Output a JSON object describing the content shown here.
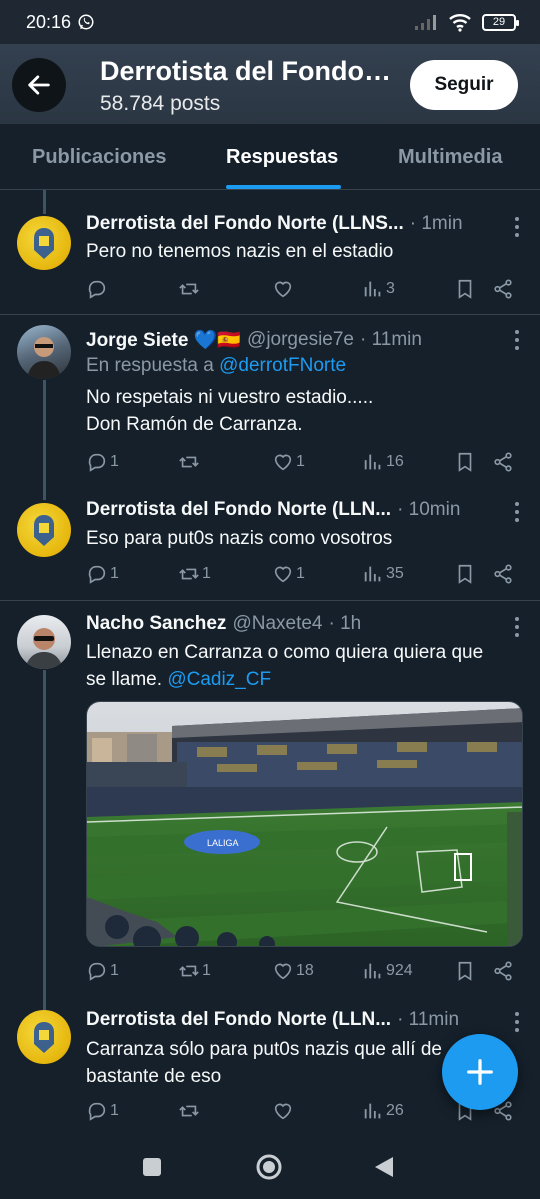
{
  "status_bar": {
    "time": "20:16",
    "battery": "29"
  },
  "header": {
    "title": "Derrotista del Fondo Norte (LLNS)",
    "posts_count": "58.784 posts",
    "follow_label": "Seguir"
  },
  "tabs": [
    {
      "label": "Publicaciones",
      "active": false
    },
    {
      "label": "Respuestas",
      "active": true
    },
    {
      "label": "Multimedia",
      "active": false
    }
  ],
  "tweets": [
    {
      "name": "Derrotista del Fondo Norte (LLNS...",
      "time": "1min",
      "text": "Pero no tenemos nazis en el estadio",
      "replies": "",
      "retweets": "",
      "likes": "",
      "views": "3"
    },
    {
      "name": "Jorge Siete 💙🇪🇸",
      "handle": "@jorgesie7e",
      "time": "11min",
      "reply_prefix": "En respuesta a",
      "reply_handle": "@derrotFNorte",
      "text_line1": "No respetais ni vuestro estadio.....",
      "text_line2": "Don Ramón de Carranza.",
      "replies": "1",
      "retweets": "",
      "likes": "1",
      "views": "16"
    },
    {
      "name": "Derrotista del Fondo Norte (LLN...",
      "time": "10min",
      "text": "Eso para put0s nazis como vosotros",
      "replies": "1",
      "retweets": "1",
      "likes": "1",
      "views": "35"
    },
    {
      "name": "Nacho Sanchez",
      "handle": "@Naxete4",
      "time": "1h",
      "text_line1": "Llenazo en Carranza o como quiera quiera que",
      "text_line2": "se llame.",
      "mention": "@Cadiz_CF",
      "replies": "1",
      "retweets": "1",
      "likes": "18",
      "views": "924"
    },
    {
      "name": "Derrotista del Fondo Norte (LLN...",
      "time": "11min",
      "text_line1": "Carranza sólo para put0s nazis que allí",
      "text_line1_hidden": "de",
      "text_line2": "bastante de eso",
      "replies": "1",
      "retweets": "",
      "likes": "",
      "views": "26"
    }
  ],
  "colors": {
    "accent": "#1d9bf0",
    "background": "#15202b",
    "secondary_text": "#8b98a5"
  }
}
